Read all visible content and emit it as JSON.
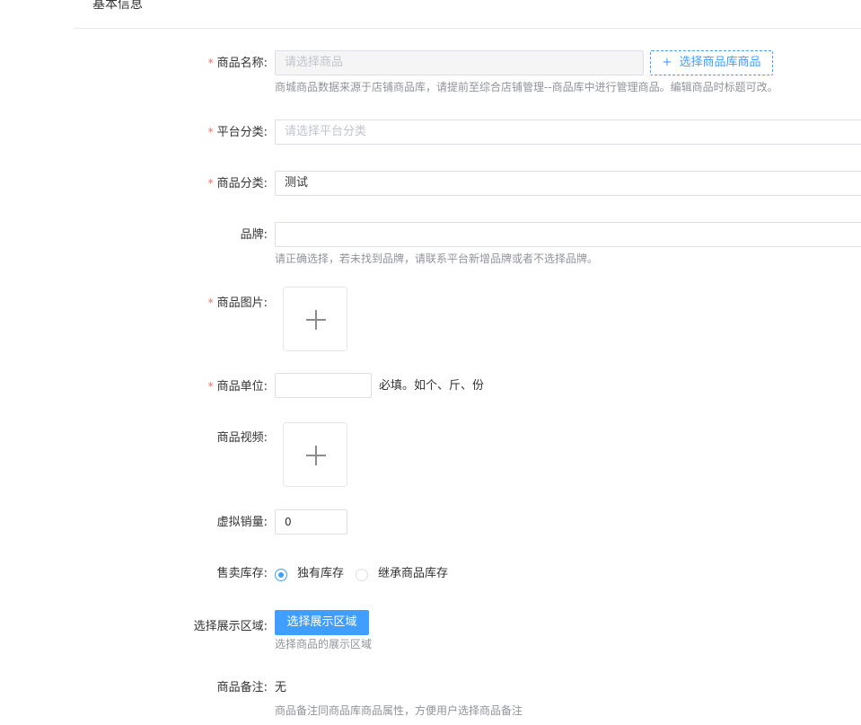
{
  "section": {
    "title": "基本信息"
  },
  "form": {
    "product_name": {
      "label": "商品名称:",
      "placeholder": "请选择商品",
      "select_button": "选择商品库商品",
      "hint": "商城商品数据来源于店铺商品库，请提前至综合店铺管理--商品库中进行管理商品。编辑商品时标题可改。"
    },
    "platform_category": {
      "label": "平台分类:",
      "placeholder": "请选择平台分类"
    },
    "product_category": {
      "label": "商品分类:",
      "value": "测试"
    },
    "brand": {
      "label": "品牌:",
      "value": "",
      "hint": "请正确选择，若未找到品牌，请联系平台新增品牌或者不选择品牌。"
    },
    "product_image": {
      "label": "商品图片:"
    },
    "product_unit": {
      "label": "商品单位:",
      "value": "",
      "hint": "必填。如个、斤、份"
    },
    "product_video": {
      "label": "商品视频:"
    },
    "virtual_sales": {
      "label": "虚拟销量:",
      "value": "0"
    },
    "sale_stock": {
      "label": "售卖库存:",
      "options": [
        {
          "label": "独有库存",
          "checked": true
        },
        {
          "label": "继承商品库存",
          "checked": false
        }
      ]
    },
    "display_area": {
      "label": "选择展示区域:",
      "button": "选择展示区域",
      "hint": "选择商品的展示区域"
    },
    "remark": {
      "label": "商品备注:",
      "value": "无",
      "hint": "商品备注同商品库商品属性，方便用户选择商品备注"
    }
  },
  "colors": {
    "primary": "#409eff",
    "required": "#f56c6c",
    "hint": "#909399",
    "border": "#dcdfe6"
  },
  "icons": {
    "upload": "plus-icon",
    "add": "plus-icon"
  }
}
